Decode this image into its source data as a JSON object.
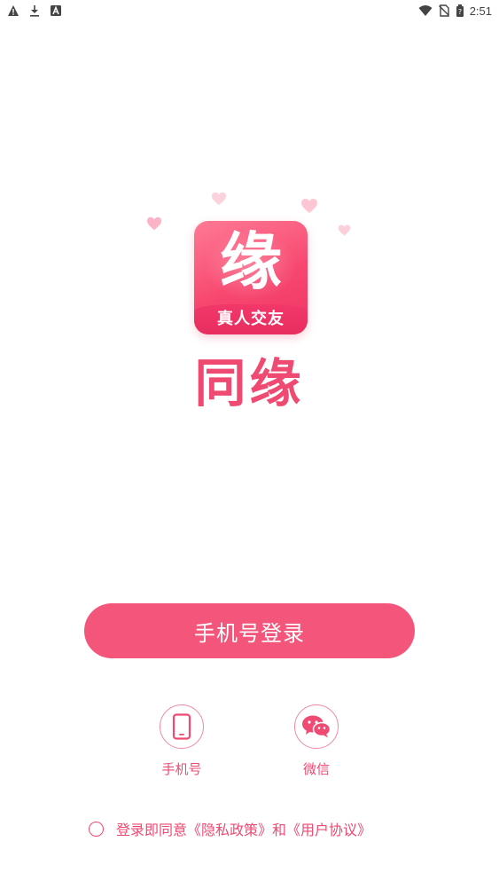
{
  "status_bar": {
    "time": "2:51",
    "left_icons": [
      "warning-icon",
      "download-icon",
      "app-notification-icon"
    ],
    "right_icons": [
      "wifi-icon",
      "no-sim-icon",
      "battery-icon"
    ]
  },
  "logo": {
    "char": "缘",
    "ribbon": "真人交友"
  },
  "app_name": "同缘",
  "primary_login": {
    "label": "手机号登录"
  },
  "alt_logins": [
    {
      "label": "手机号",
      "icon": "phone-icon"
    },
    {
      "label": "微信",
      "icon": "wechat-icon"
    }
  ],
  "agreement": {
    "prefix": "登录即同意",
    "privacy": "《隐私政策》",
    "and": "和",
    "terms": "《用户协议》"
  },
  "colors": {
    "brand": "#f4567b",
    "title": "#ee4a72",
    "heart": "#fbc5d3"
  }
}
